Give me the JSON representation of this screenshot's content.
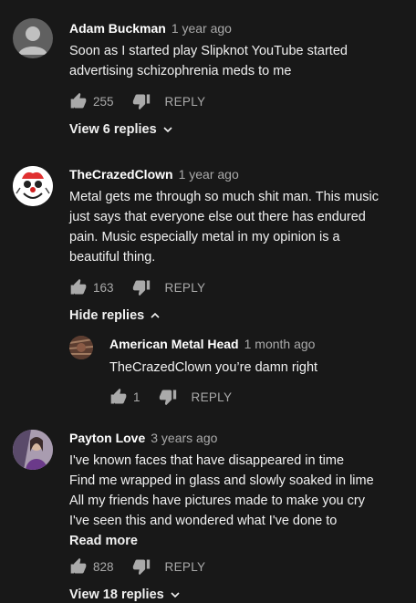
{
  "comments": [
    {
      "author": "Adam Buckman",
      "time": "1 year ago",
      "lines": [
        "Soon as I started play Slipknot YouTube started",
        "advertising schizophrenia meds to me"
      ],
      "likes": "255",
      "reply_label": "REPLY",
      "toggle_label": "View 6 replies"
    },
    {
      "author": "TheCrazedClown",
      "time": "1 year ago",
      "lines": [
        "Metal gets me through so much shit man. This music",
        "just says that everyone else out there has endured",
        "pain. Music especially metal in my opinion is a",
        "beautiful thing."
      ],
      "likes": "163",
      "reply_label": "REPLY",
      "toggle_label": "Hide replies",
      "reply": {
        "author": "American Metal Head",
        "time": "1 month ago",
        "text": "TheCrazedClown you’re damn right",
        "likes": "1",
        "reply_label": "REPLY"
      }
    },
    {
      "author": "Payton Love",
      "time": "3 years ago",
      "lines": [
        "I've known faces that have disappeared in time",
        "Find me wrapped in glass and slowly soaked in lime",
        "All my friends have pictures made to make you cry",
        "I've seen this and wondered what I've done to"
      ],
      "read_more": "Read more",
      "likes": "828",
      "reply_label": "REPLY",
      "toggle_label": "View 18 replies"
    }
  ]
}
